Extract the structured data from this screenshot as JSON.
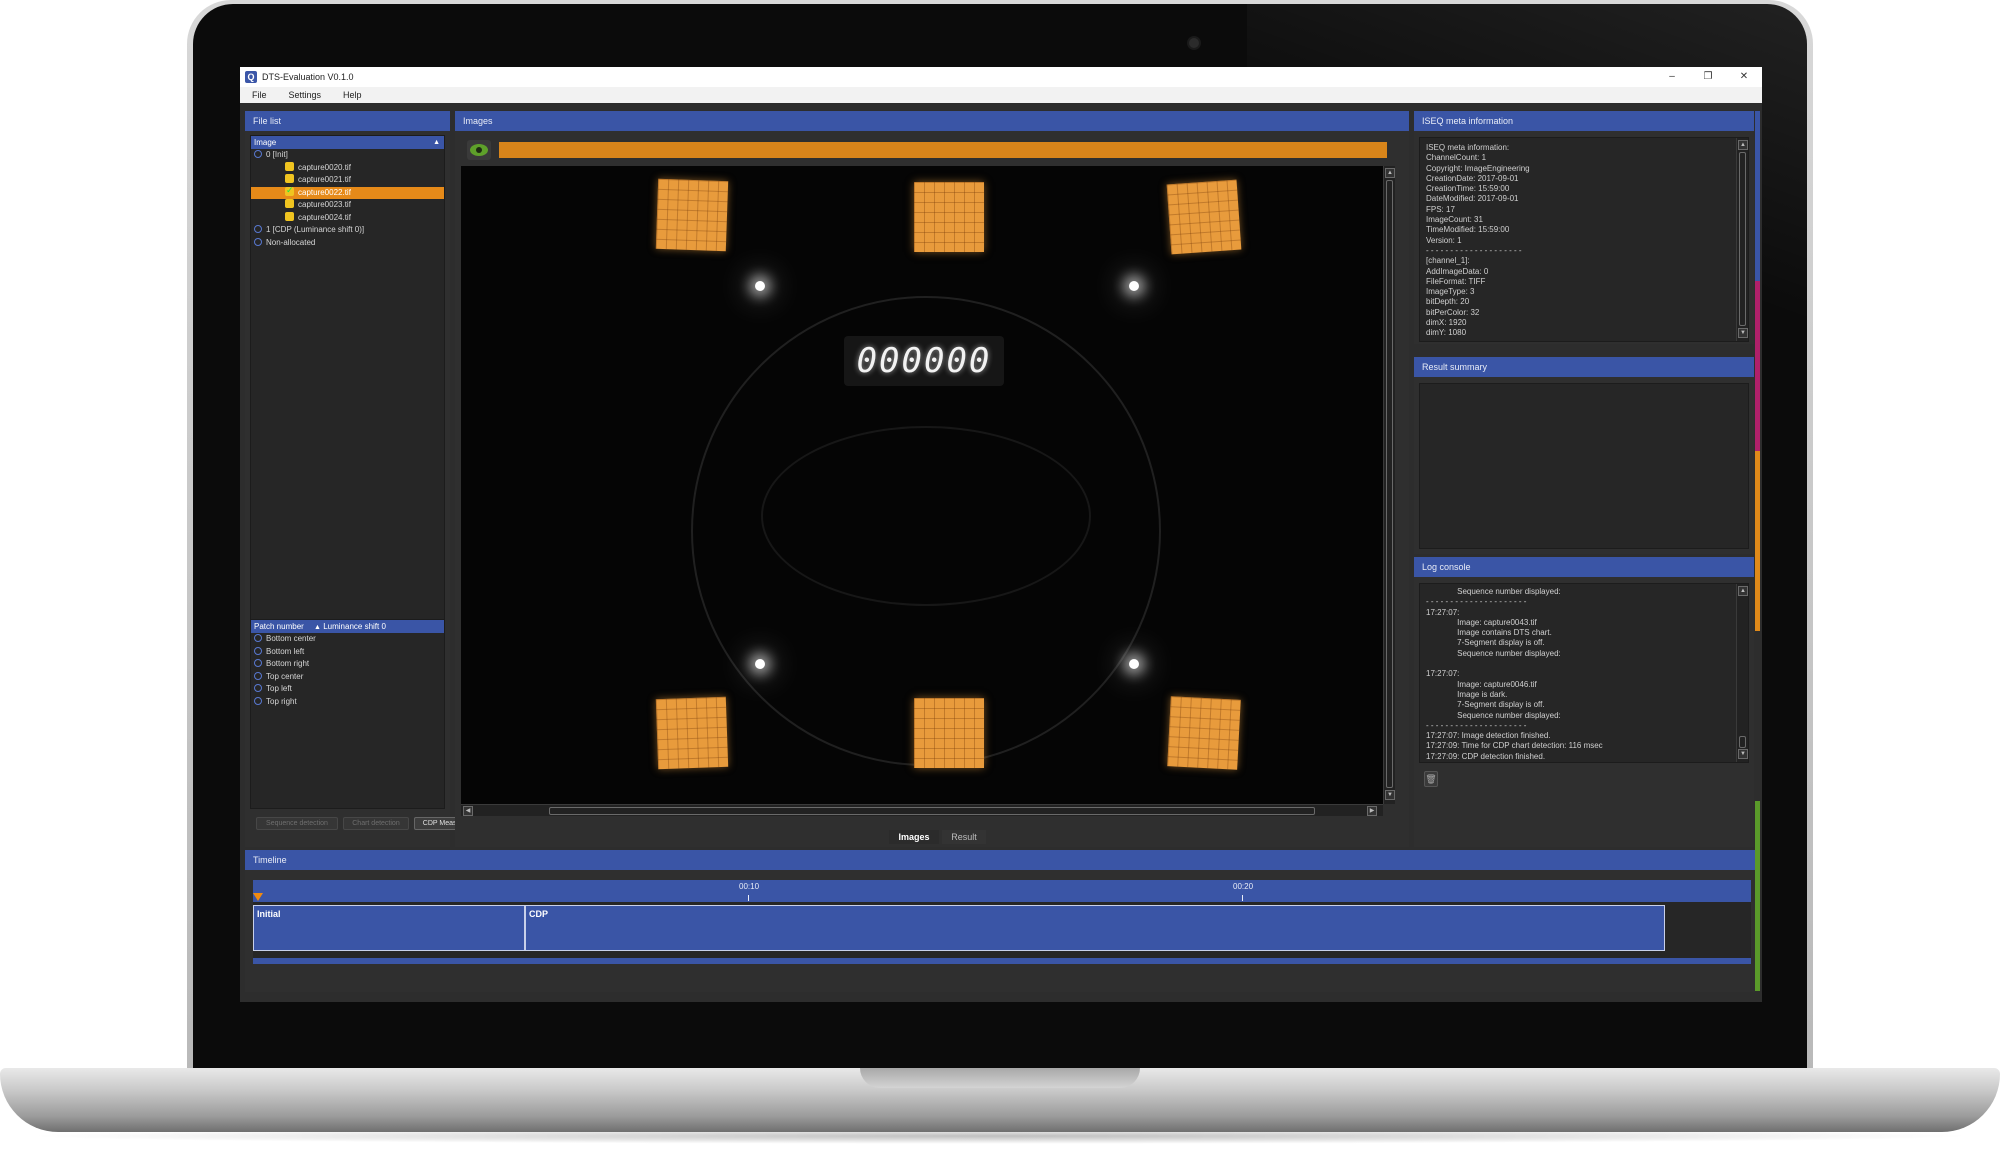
{
  "window": {
    "title": "DTS-Evaluation V0.1.0",
    "controls": [
      "–",
      "❐",
      "✕"
    ]
  },
  "menu": [
    "File",
    "Settings",
    "Help"
  ],
  "file_list": {
    "title": "File list",
    "tree_header": "Image",
    "rows": [
      {
        "label": "0 [Init]"
      },
      {
        "label": "capture0020.tif"
      },
      {
        "label": "capture0021.tif"
      },
      {
        "label": "capture0022.tif"
      },
      {
        "label": "capture0023.tif"
      },
      {
        "label": "capture0024.tif"
      },
      {
        "label": "1 [CDP (Luminance shift 0)]"
      },
      {
        "label": "Non-allocated"
      }
    ],
    "patch_header": "Patch number",
    "patch_header_value": "Luminance shift 0",
    "patches": [
      "Bottom center",
      "Bottom left",
      "Bottom right",
      "Top center",
      "Top left",
      "Top right"
    ],
    "buttons": [
      "Sequence detection",
      "Chart detection",
      "CDP Measurement"
    ]
  },
  "images": {
    "title": "Images",
    "segment_display": "000000",
    "tabs": [
      "Images",
      "Result"
    ]
  },
  "meta": {
    "title": "ISEQ meta information",
    "text": "ISEQ meta information:\nChannelCount: 1\nCopyright: ImageEngineering\nCreationDate: 2017-09-01\nCreationTime: 15:59:00\nDateModified: 2017-09-01\nFPS: 17\nImageCount: 31\nTimeModified: 15:59:00\nVersion: 1\n- - - - - - - - - - - - - - - - - - - -\n[channel_1]:\nAddImageData: 0\nFileFormat: TIFF\nImageType: 3\nbitDepth: 20\nbitPerColor: 32\ndimX: 1920\ndimY: 1080"
  },
  "result_summary": {
    "title": "Result summary"
  },
  "log": {
    "title": "Log console",
    "text": "              Sequence number displayed:\n- - - - - - - - - - - - - - - - - - - - -\n17:27:07:\n              Image: capture0043.tif\n              Image contains DTS chart.\n              7-Segment display is off.\n              Sequence number displayed:\n\n17:27:07:\n              Image: capture0046.tif\n              Image is dark.\n              7-Segment display is off.\n              Sequence number displayed:\n- - - - - - - - - - - - - - - - - - - - -\n17:27:07: Image detection finished.\n17:27:09: Time for CDP chart detection: 116 msec\n17:27:09: CDP detection finished."
  },
  "timeline": {
    "title": "Timeline",
    "ticks": [
      "00:10",
      "00:20"
    ],
    "segments": [
      "Initial",
      "CDP"
    ]
  },
  "colors": {
    "panel_header": "#3a55a6",
    "selection": "#e68a19",
    "progress": "#d9851a",
    "accents": [
      "#3a55a6",
      "#b0206a",
      "#e08a1a",
      "#5a9a2a"
    ]
  }
}
